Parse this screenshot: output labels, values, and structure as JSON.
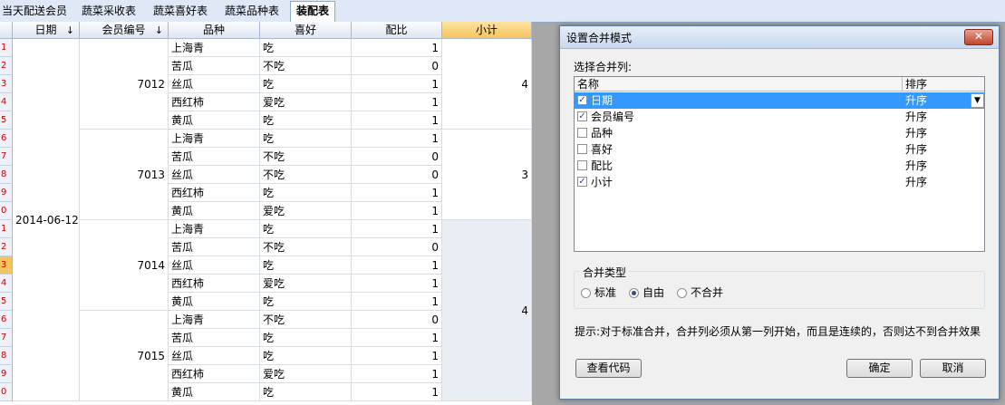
{
  "tabs": [
    {
      "label": "当天配送会员",
      "active": false
    },
    {
      "label": "蔬菜采收表",
      "active": false
    },
    {
      "label": "蔬菜喜好表",
      "active": false
    },
    {
      "label": "蔬菜品种表",
      "active": false
    },
    {
      "label": "装配表",
      "active": true
    }
  ],
  "grid": {
    "columns": [
      "日期",
      "会员编号",
      "品种",
      "喜好",
      "配比",
      "小计"
    ],
    "sort_arrow": "↓",
    "date": "2014-06-12",
    "groups": [
      {
        "member": "7012",
        "subtotal": "4",
        "rows": [
          {
            "row_no": "1",
            "variety": "上海青",
            "pref": "吃",
            "ratio": "1"
          },
          {
            "row_no": "2",
            "variety": "苦瓜",
            "pref": "不吃",
            "ratio": "0"
          },
          {
            "row_no": "3",
            "variety": "丝瓜",
            "pref": "吃",
            "ratio": "1"
          },
          {
            "row_no": "4",
            "variety": "西红柿",
            "pref": "爱吃",
            "ratio": "1"
          },
          {
            "row_no": "5",
            "variety": "黄瓜",
            "pref": "吃",
            "ratio": "1"
          }
        ]
      },
      {
        "member": "7013",
        "subtotal": "3",
        "rows": [
          {
            "row_no": "6",
            "variety": "上海青",
            "pref": "吃",
            "ratio": "1"
          },
          {
            "row_no": "7",
            "variety": "苦瓜",
            "pref": "不吃",
            "ratio": "0"
          },
          {
            "row_no": "8",
            "variety": "丝瓜",
            "pref": "不吃",
            "ratio": "0"
          },
          {
            "row_no": "9",
            "variety": "西红柿",
            "pref": "吃",
            "ratio": "1"
          },
          {
            "row_no": "0",
            "variety": "黄瓜",
            "pref": "爱吃",
            "ratio": "1"
          }
        ]
      },
      {
        "member": "7014",
        "rows": [
          {
            "row_no": "1",
            "variety": "上海青",
            "pref": "吃",
            "ratio": "1"
          },
          {
            "row_no": "2",
            "variety": "苦瓜",
            "pref": "不吃",
            "ratio": "0"
          },
          {
            "row_no": "3",
            "variety": "丝瓜",
            "pref": "吃",
            "ratio": "1"
          },
          {
            "row_no": "4",
            "variety": "西红柿",
            "pref": "爱吃",
            "ratio": "1"
          },
          {
            "row_no": "5",
            "variety": "黄瓜",
            "pref": "吃",
            "ratio": "1"
          }
        ]
      },
      {
        "member": "7015",
        "rows": [
          {
            "row_no": "6",
            "variety": "上海青",
            "pref": "不吃",
            "ratio": "0"
          },
          {
            "row_no": "7",
            "variety": "苦瓜",
            "pref": "吃",
            "ratio": "1"
          },
          {
            "row_no": "8",
            "variety": "丝瓜",
            "pref": "吃",
            "ratio": "1"
          },
          {
            "row_no": "9",
            "variety": "西红柿",
            "pref": "爱吃",
            "ratio": "1"
          },
          {
            "row_no": "0",
            "variety": "黄瓜",
            "pref": "吃",
            "ratio": "1"
          }
        ]
      }
    ],
    "merged_subtotal_34": "4",
    "current_row_no": "3"
  },
  "dialog": {
    "title": "设置合并模式",
    "close_glyph": "✕",
    "select_label": "选择合并列:",
    "list_headers": {
      "name": "名称",
      "sort": "排序"
    },
    "columns": [
      {
        "name": "日期",
        "checked": true,
        "sort": "升序",
        "selected": true
      },
      {
        "name": "会员编号",
        "checked": true,
        "sort": "升序",
        "selected": false
      },
      {
        "name": "品种",
        "checked": false,
        "sort": "升序",
        "selected": false
      },
      {
        "name": "喜好",
        "checked": false,
        "sort": "升序",
        "selected": false
      },
      {
        "name": "配比",
        "checked": false,
        "sort": "升序",
        "selected": false
      },
      {
        "name": "小计",
        "checked": true,
        "sort": "升序",
        "selected": false
      }
    ],
    "dropdown_glyph": "▼",
    "check_glyph": "✓",
    "merge_type_label": "合并类型",
    "merge_types": [
      {
        "label": "标准",
        "selected": false
      },
      {
        "label": "自由",
        "selected": true
      },
      {
        "label": "不合并",
        "selected": false
      }
    ],
    "hint": "提示:对于标准合并，合并列必须从第一列开始，而且是连续的，否则达不到合并效果",
    "view_code_label": "查看代码",
    "ok_label": "确定",
    "cancel_label": "取消"
  }
}
